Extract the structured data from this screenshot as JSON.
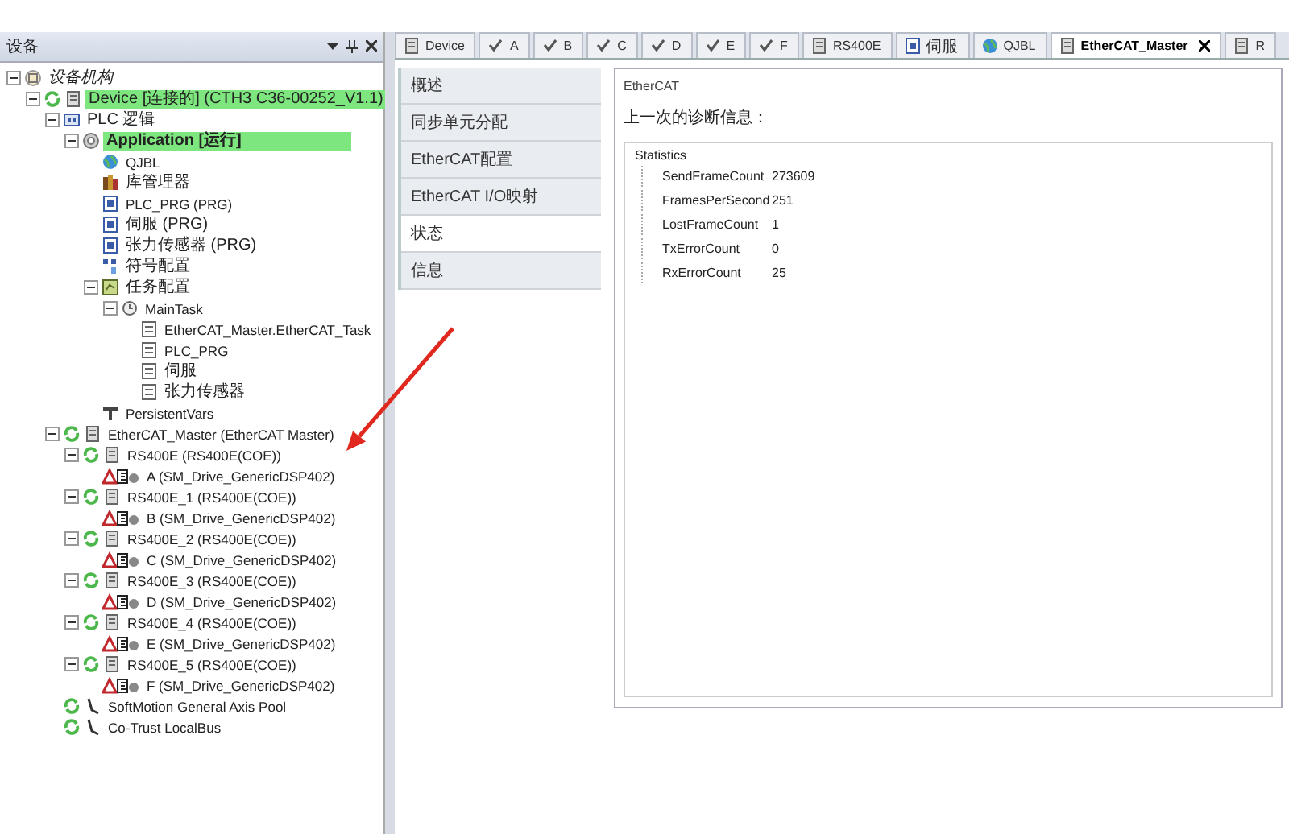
{
  "panel": {
    "title": "设备"
  },
  "tree": [
    {
      "label": "设备机构",
      "kind": "root",
      "online": false,
      "highlighted": false,
      "children": [
        {
          "label": "Device [连接的] (CTH3 C36-00252_V1.1)",
          "kind": "device",
          "online": true,
          "highlighted": true,
          "children": [
            {
              "label": "PLC 逻辑",
              "kind": "plc",
              "online": false,
              "highlighted": false,
              "children": [
                {
                  "label": "Application [运行]",
                  "kind": "app",
                  "online": false,
                  "highlighted": true,
                  "children": [
                    {
                      "label": "QJBL",
                      "kind": "globe",
                      "online": false,
                      "highlighted": false
                    },
                    {
                      "label": "库管理器",
                      "kind": "library",
                      "online": false,
                      "highlighted": false
                    },
                    {
                      "label": "PLC_PRG (PRG)",
                      "kind": "pou",
                      "online": false,
                      "highlighted": false
                    },
                    {
                      "label": "伺服 (PRG)",
                      "kind": "pou",
                      "online": false,
                      "highlighted": false
                    },
                    {
                      "label": "张力传感器 (PRG)",
                      "kind": "pou",
                      "online": false,
                      "highlighted": false
                    },
                    {
                      "label": "符号配置",
                      "kind": "symbol",
                      "online": false,
                      "highlighted": false
                    },
                    {
                      "label": "任务配置",
                      "kind": "task",
                      "online": false,
                      "highlighted": false,
                      "children": [
                        {
                          "label": "MainTask",
                          "kind": "maintask",
                          "online": false,
                          "highlighted": false,
                          "children": [
                            {
                              "label": "EtherCAT_Master.EtherCAT_Task",
                              "kind": "call",
                              "online": false,
                              "highlighted": false
                            },
                            {
                              "label": "PLC_PRG",
                              "kind": "call",
                              "online": false,
                              "highlighted": false
                            },
                            {
                              "label": "伺服",
                              "kind": "call",
                              "online": false,
                              "highlighted": false
                            },
                            {
                              "label": "张力传感器",
                              "kind": "call",
                              "online": false,
                              "highlighted": false
                            }
                          ]
                        }
                      ]
                    },
                    {
                      "label": "PersistentVars",
                      "kind": "persistent",
                      "online": false,
                      "highlighted": false
                    }
                  ]
                }
              ]
            },
            {
              "label": "EtherCAT_Master (EtherCAT Master)",
              "kind": "module",
              "online": true,
              "highlighted": false,
              "children": [
                {
                  "label": "RS400E (RS400E(COE))",
                  "kind": "module",
                  "online": true,
                  "highlighted": false,
                  "children": [
                    {
                      "label": "A (SM_Drive_GenericDSP402)",
                      "kind": "axis",
                      "online": false,
                      "highlighted": false
                    }
                  ]
                },
                {
                  "label": "RS400E_1 (RS400E(COE))",
                  "kind": "module",
                  "online": true,
                  "highlighted": false,
                  "children": [
                    {
                      "label": "B (SM_Drive_GenericDSP402)",
                      "kind": "axis",
                      "online": false,
                      "highlighted": false
                    }
                  ]
                },
                {
                  "label": "RS400E_2 (RS400E(COE))",
                  "kind": "module",
                  "online": true,
                  "highlighted": false,
                  "children": [
                    {
                      "label": "C (SM_Drive_GenericDSP402)",
                      "kind": "axis",
                      "online": false,
                      "highlighted": false
                    }
                  ]
                },
                {
                  "label": "RS400E_3 (RS400E(COE))",
                  "kind": "module",
                  "online": true,
                  "highlighted": false,
                  "children": [
                    {
                      "label": "D (SM_Drive_GenericDSP402)",
                      "kind": "axis",
                      "online": false,
                      "highlighted": false
                    }
                  ]
                },
                {
                  "label": "RS400E_4 (RS400E(COE))",
                  "kind": "module",
                  "online": true,
                  "highlighted": false,
                  "children": [
                    {
                      "label": "E (SM_Drive_GenericDSP402)",
                      "kind": "axis",
                      "online": false,
                      "highlighted": false
                    }
                  ]
                },
                {
                  "label": "RS400E_5 (RS400E(COE))",
                  "kind": "module",
                  "online": true,
                  "highlighted": false,
                  "children": [
                    {
                      "label": "F (SM_Drive_GenericDSP402)",
                      "kind": "axis",
                      "online": false,
                      "highlighted": false
                    }
                  ]
                }
              ]
            },
            {
              "label": "SoftMotion General Axis Pool",
              "kind": "pool",
              "online": true,
              "highlighted": false
            },
            {
              "label": "Co-Trust LocalBus",
              "kind": "pool",
              "online": true,
              "highlighted": false
            }
          ]
        }
      ]
    }
  ],
  "tabs": [
    {
      "label": "Device",
      "kind": "module",
      "selected": false
    },
    {
      "label": "A",
      "kind": "check",
      "selected": false
    },
    {
      "label": "B",
      "kind": "check",
      "selected": false
    },
    {
      "label": "C",
      "kind": "check",
      "selected": false
    },
    {
      "label": "D",
      "kind": "check",
      "selected": false
    },
    {
      "label": "E",
      "kind": "check",
      "selected": false
    },
    {
      "label": "F",
      "kind": "check",
      "selected": false
    },
    {
      "label": "RS400E",
      "kind": "module",
      "selected": false
    },
    {
      "label": "伺服",
      "kind": "pou",
      "selected": false
    },
    {
      "label": "QJBL",
      "kind": "globe",
      "selected": false
    },
    {
      "label": "EtherCAT_Master",
      "kind": "module",
      "selected": true
    },
    {
      "label": "R",
      "kind": "module",
      "selected": false
    }
  ],
  "side_tabs": [
    {
      "label": "概述",
      "selected": false
    },
    {
      "label": "同步单元分配",
      "selected": false
    },
    {
      "label": "EtherCAT配置",
      "selected": false
    },
    {
      "label": "EtherCAT I/O映射",
      "selected": false
    },
    {
      "label": "状态",
      "selected": true
    },
    {
      "label": "信息",
      "selected": false
    }
  ],
  "content": {
    "group_title": "EtherCAT",
    "heading": "上一次的诊断信息：",
    "statistics": {
      "title": "Statistics",
      "rows": [
        {
          "name": "SendFrameCount",
          "value": "273609"
        },
        {
          "name": "FramesPerSecond",
          "value": "251"
        },
        {
          "name": "LostFrameCount",
          "value": "1"
        },
        {
          "name": "TxErrorCount",
          "value": "0"
        },
        {
          "name": "RxErrorCount",
          "value": "25"
        }
      ]
    }
  }
}
